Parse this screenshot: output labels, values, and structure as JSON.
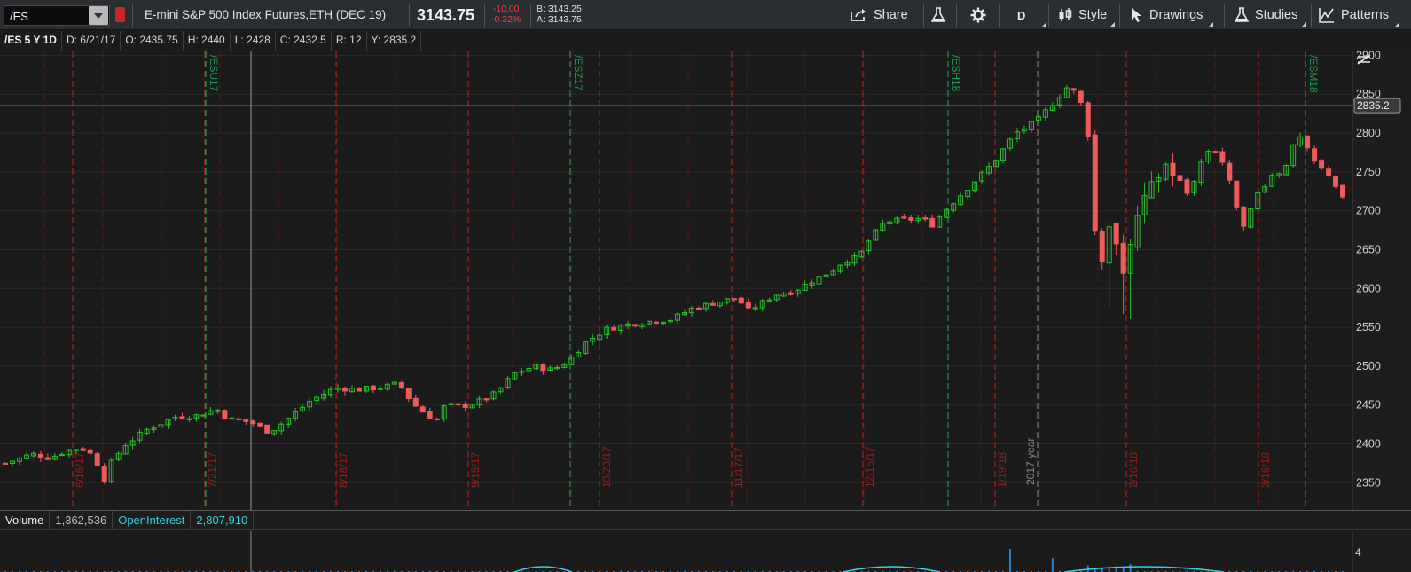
{
  "toolbar": {
    "symbol": "/ES",
    "description": "E-mini S&P 500 Index Futures,ETH (DEC 19)",
    "last_price": "3143.75",
    "net_change": "-10.00",
    "pct_change": "-0.32%",
    "bid": "B: 3143.25",
    "ask": "A: 3143.75",
    "share_label": "Share",
    "timeframe_label": "D",
    "style_label": "Style",
    "drawings_label": "Drawings",
    "studies_label": "Studies",
    "patterns_label": "Patterns"
  },
  "infobar": {
    "title": "/ES 5 Y 1D",
    "date": "D: 6/21/17",
    "open": "O: 2435.75",
    "high": "H: 2440",
    "low": "L: 2428",
    "close": "C: 2432.5",
    "range": "R: 12",
    "y": "Y: 2835.2"
  },
  "colors": {
    "up": "#27c227",
    "down": "#ee5b5b",
    "grid": "#2a2a2a",
    "expiry_green": "#1faa55",
    "month_red": "#c81f1f",
    "accent_cyan": "#2fd4e4",
    "background": "#1b1b1b"
  },
  "chart_data": {
    "type": "candlestick",
    "ylim": [
      2315,
      2905
    ],
    "y_ticks": [
      "2350",
      "2400",
      "2450",
      "2500",
      "2550",
      "2600",
      "2650",
      "2700",
      "2750",
      "2800",
      "2850",
      "2900"
    ],
    "crosshair_value": "2835.2",
    "date_markers": [
      {
        "label": "6/16/17"
      },
      {
        "label": "7/21/17"
      },
      {
        "label": "8/18/17"
      },
      {
        "label": "9/15/17"
      },
      {
        "label": "10/20/17"
      },
      {
        "label": "11/17/17"
      },
      {
        "label": "12/15/17"
      },
      {
        "label": "1/19/18"
      },
      {
        "label": "2/16/18"
      },
      {
        "label": "3/16/18"
      }
    ],
    "expiry_markers": [
      {
        "label": "/ESU17"
      },
      {
        "label": "/ESZ17"
      },
      {
        "label": "/ESH18"
      },
      {
        "label": "/ESM18"
      }
    ],
    "year_marker": "2017 year",
    "path": [
      [
        0,
        2375
      ],
      [
        18,
        2387
      ],
      [
        30,
        2382
      ],
      [
        42,
        2392
      ],
      [
        52,
        2395
      ],
      [
        58,
        2386
      ],
      [
        64,
        2368
      ],
      [
        66,
        2352
      ],
      [
        70,
        2372
      ],
      [
        80,
        2398
      ],
      [
        95,
        2418
      ],
      [
        115,
        2435
      ],
      [
        128,
        2436
      ],
      [
        142,
        2445
      ],
      [
        150,
        2432
      ],
      [
        165,
        2428
      ],
      [
        178,
        2415
      ],
      [
        190,
        2432
      ],
      [
        205,
        2455
      ],
      [
        222,
        2472
      ],
      [
        238,
        2470
      ],
      [
        254,
        2473
      ],
      [
        265,
        2478
      ],
      [
        274,
        2452
      ],
      [
        282,
        2440
      ],
      [
        290,
        2430
      ],
      [
        296,
        2450
      ],
      [
        306,
        2448
      ],
      [
        316,
        2452
      ],
      [
        330,
        2465
      ],
      [
        342,
        2490
      ],
      [
        356,
        2500
      ],
      [
        368,
        2495
      ],
      [
        378,
        2505
      ],
      [
        390,
        2530
      ],
      [
        405,
        2548
      ],
      [
        420,
        2554
      ],
      [
        435,
        2558
      ],
      [
        448,
        2560
      ],
      [
        462,
        2574
      ],
      [
        478,
        2582
      ],
      [
        492,
        2588
      ],
      [
        500,
        2572
      ],
      [
        508,
        2580
      ],
      [
        518,
        2592
      ],
      [
        530,
        2596
      ],
      [
        545,
        2612
      ],
      [
        556,
        2622
      ],
      [
        564,
        2635
      ],
      [
        574,
        2640
      ],
      [
        582,
        2664
      ],
      [
        592,
        2686
      ],
      [
        604,
        2688
      ],
      [
        616,
        2690
      ],
      [
        624,
        2682
      ],
      [
        632,
        2700
      ],
      [
        648,
        2730
      ],
      [
        664,
        2760
      ],
      [
        680,
        2800
      ],
      [
        694,
        2815
      ],
      [
        708,
        2845
      ],
      [
        716,
        2862
      ],
      [
        722,
        2845
      ],
      [
        726,
        2830
      ],
      [
        730,
        2780
      ],
      [
        733,
        2680
      ],
      [
        736,
        2620
      ],
      [
        740,
        2660
      ],
      [
        746,
        2680
      ],
      [
        752,
        2625
      ],
      [
        758,
        2670
      ],
      [
        764,
        2700
      ],
      [
        772,
        2730
      ],
      [
        780,
        2760
      ],
      [
        788,
        2745
      ],
      [
        796,
        2720
      ],
      [
        804,
        2760
      ],
      [
        812,
        2785
      ],
      [
        820,
        2760
      ],
      [
        828,
        2710
      ],
      [
        834,
        2680
      ],
      [
        842,
        2720
      ],
      [
        852,
        2745
      ],
      [
        860,
        2752
      ],
      [
        866,
        2780
      ],
      [
        872,
        2795
      ],
      [
        878,
        2770
      ],
      [
        884,
        2755
      ],
      [
        890,
        2748
      ],
      [
        896,
        2730
      ],
      [
        900,
        2715
      ]
    ]
  },
  "volume_panel": {
    "volume_label": "Volume",
    "volume_value": "1,362,536",
    "oi_label": "OpenInterest",
    "oi_value": "2,807,910",
    "scale_label": "4"
  }
}
